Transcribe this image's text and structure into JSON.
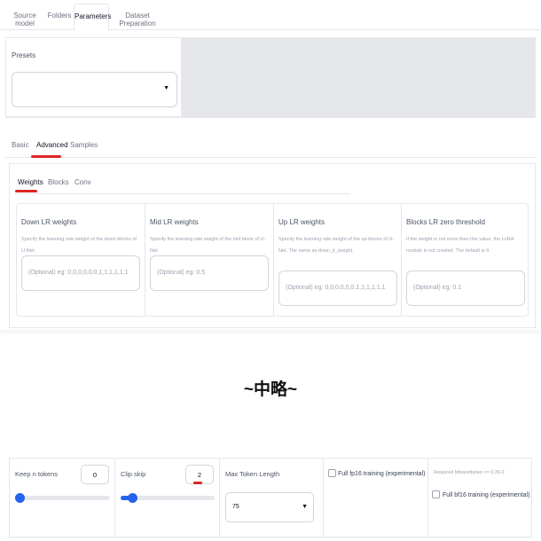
{
  "top_tabs": [
    {
      "label": "Source model"
    },
    {
      "label": "Folders"
    },
    {
      "label": "Parameters"
    },
    {
      "label": "Dataset Preparation"
    }
  ],
  "presets": {
    "label": "Presets",
    "value": ""
  },
  "sub_tabs": [
    {
      "label": "Basic"
    },
    {
      "label": "Advanced"
    },
    {
      "label": "Samples"
    }
  ],
  "inner_tabs": [
    {
      "label": "Weights"
    },
    {
      "label": "Blocks"
    },
    {
      "label": "Conv"
    }
  ],
  "weights": [
    {
      "title": "Down LR weights",
      "desc": "Specify the learning rate weight of the down blocks of U-Net.",
      "placeholder": "(Optional) eg: 0,0,0,0,0,0,1,1,1,1,1,1"
    },
    {
      "title": "Mid LR weights",
      "desc": "Specify the learning rate weight of the mid block of U-Net.",
      "placeholder": "(Optional) eg: 0.5"
    },
    {
      "title": "Up LR weights",
      "desc": "Specify the learning rate weight of the up blocks of U-Net. The same as down_lr_weight.",
      "placeholder": "(Optional) eg: 0,0,0,0,0,0,1,1,1,1,1,1"
    },
    {
      "title": "Blocks LR zero threshold",
      "desc": "If the weight is not more than this value, the LoRA module is not created. The default is 0.",
      "placeholder": "(Optional) eg: 0.1"
    }
  ],
  "omitted_text": "~中略~",
  "bottom": {
    "keep_n_tokens": {
      "label": "Keep n tokens",
      "value": "0",
      "fraction": 0
    },
    "clip_skip": {
      "label": "Clip skip",
      "value": "2",
      "fraction": 0.083
    },
    "max_token_length": {
      "label": "Max Token Length",
      "value": "75"
    },
    "full_fp16": {
      "label": "Full fp16 training (experimental)",
      "checked": false
    },
    "full_bf16": {
      "note": "Required bitsandbytes >= 0.36.0",
      "label": "Full bf16 training (experimental)",
      "checked": false
    }
  },
  "colors": {
    "accent": "#2563eb",
    "highlight": "#dc2626"
  }
}
